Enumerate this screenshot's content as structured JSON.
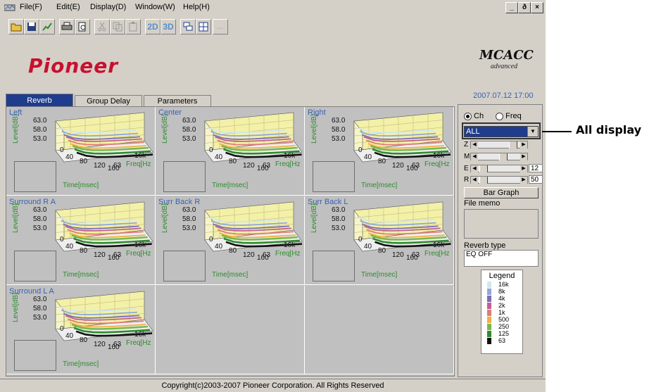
{
  "menu": {
    "items": [
      "File(F)",
      "Edit(E)",
      "Display(D)",
      "Window(W)",
      "Help(H)"
    ]
  },
  "window_buttons": {
    "minimize": "_",
    "restore": "ð",
    "close": "×"
  },
  "toolbar": {
    "icons": [
      "open-folder-icon",
      "save-icon",
      "graph-icon",
      "print-icon",
      "print-preview-icon",
      "cut-icon",
      "copy-icon",
      "paste-icon"
    ],
    "btn_2d": "2D",
    "btn_3d": "3D",
    "btn_more": "..."
  },
  "brand": {
    "logo": "Pioneer",
    "mcacc": "MCACC",
    "mcacc_sub": "advanced"
  },
  "datetime": "2007.07.12 17:00",
  "tabs": [
    "Reverb",
    "Group Delay",
    "Parameters"
  ],
  "channels": [
    {
      "name": "Left"
    },
    {
      "name": "Center"
    },
    {
      "name": "Right"
    },
    {
      "name": "Surround R A"
    },
    {
      "name": "Surr Back R"
    },
    {
      "name": "Surr Back L"
    },
    {
      "name": "Surround L A"
    }
  ],
  "plot_labels": {
    "y_axis": "Level[dB]",
    "y_ticks": [
      "63.0",
      "58.0",
      "53.0"
    ],
    "x_ticks": [
      "0",
      "40",
      "80",
      "120",
      "160"
    ],
    "freq_ticks": [
      "63",
      "16k"
    ],
    "freq_axis": "Freq[Hz",
    "time_axis": "Time[msec]"
  },
  "panel": {
    "radio_ch": "Ch",
    "radio_freq": "Freq",
    "select_value": "ALL",
    "slider_labels": [
      "Z",
      "M",
      "E",
      "R"
    ],
    "e_value": "12",
    "r_value": "50",
    "bar_graph_button": "Bar Graph",
    "file_memo_label": "File memo",
    "reverb_type_label": "Reverb type",
    "reverb_type_value": "EQ OFF",
    "legend_title": "Legend",
    "legend_items": [
      {
        "label": "16k",
        "color": "#cfe7ef"
      },
      {
        "label": "8k",
        "color": "#8fa8d8"
      },
      {
        "label": "4k",
        "color": "#7a6fb8"
      },
      {
        "label": "2k",
        "color": "#c06090"
      },
      {
        "label": "1k",
        "color": "#e07a7a"
      },
      {
        "label": "500",
        "color": "#f0b040"
      },
      {
        "label": "250",
        "color": "#7ab84a"
      },
      {
        "label": "125",
        "color": "#2e8b2e"
      },
      {
        "label": "63",
        "color": "#111111"
      }
    ]
  },
  "status": "Copyright(c)2003-2007 Pioneer Corporation. All Rights Reserved",
  "callout": "All display"
}
